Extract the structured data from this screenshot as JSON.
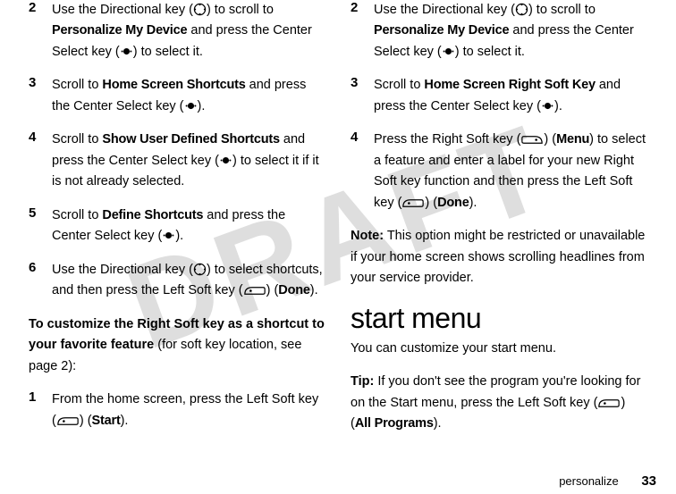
{
  "watermark": "DRAFT",
  "left_col": {
    "steps": [
      {
        "num": "2",
        "parts": [
          {
            "t": "Use the Directional key ("
          },
          {
            "icon": "dir-ring"
          },
          {
            "t": ") to scroll to "
          },
          {
            "t": "Personalize My Device",
            "bold": true
          },
          {
            "t": " and press the Center Select key ("
          },
          {
            "icon": "center-dot"
          },
          {
            "t": ") to select it."
          }
        ]
      },
      {
        "num": "3",
        "parts": [
          {
            "t": "Scroll to "
          },
          {
            "t": "Home Screen Shortcuts",
            "bold": true
          },
          {
            "t": " and press the Center Select key ("
          },
          {
            "icon": "center-dot"
          },
          {
            "t": ")."
          }
        ]
      },
      {
        "num": "4",
        "parts": [
          {
            "t": "Scroll to "
          },
          {
            "t": "Show User Defined Shortcuts",
            "bold": true
          },
          {
            "t": " and press the Center Select key ("
          },
          {
            "icon": "center-dot"
          },
          {
            "t": ") to select it if it is not already selected."
          }
        ]
      },
      {
        "num": "5",
        "parts": [
          {
            "t": "Scroll to "
          },
          {
            "t": "Define Shortcuts",
            "bold": true
          },
          {
            "t": " and press the Center Select key ("
          },
          {
            "icon": "center-dot"
          },
          {
            "t": ")."
          }
        ]
      },
      {
        "num": "6",
        "parts": [
          {
            "t": "Use the Directional key ("
          },
          {
            "icon": "dir-ring"
          },
          {
            "t": ") to select shortcuts, and then press the Left Soft key ("
          },
          {
            "icon": "left-soft"
          },
          {
            "t": ") ("
          },
          {
            "t": "Done",
            "bold": true
          },
          {
            "t": ")."
          }
        ]
      }
    ],
    "para_lead_bold": "To customize the Right Soft key as a shortcut to your favorite feature",
    "para_lead_rest": " (for soft key location, see page 2):",
    "steps2": [
      {
        "num": "1",
        "parts": [
          {
            "t": "From the home screen, press the Left Soft key ("
          },
          {
            "icon": "left-soft"
          },
          {
            "t": ") ("
          },
          {
            "t": "Start",
            "bold": true
          },
          {
            "t": ")."
          }
        ]
      }
    ]
  },
  "right_col": {
    "steps": [
      {
        "num": "2",
        "parts": [
          {
            "t": "Use the Directional key ("
          },
          {
            "icon": "dir-ring"
          },
          {
            "t": ") to scroll to "
          },
          {
            "t": "Personalize My Device",
            "bold": true
          },
          {
            "t": " and press the Center Select key ("
          },
          {
            "icon": "center-dot"
          },
          {
            "t": ") to select it."
          }
        ]
      },
      {
        "num": "3",
        "parts": [
          {
            "t": "Scroll to "
          },
          {
            "t": "Home Screen Right Soft Key",
            "bold": true
          },
          {
            "t": " and press the Center Select key ("
          },
          {
            "icon": "center-dot"
          },
          {
            "t": ")."
          }
        ]
      },
      {
        "num": "4",
        "parts": [
          {
            "t": "Press the Right Soft key ("
          },
          {
            "icon": "right-soft"
          },
          {
            "t": ") ("
          },
          {
            "t": "Menu",
            "bold": true
          },
          {
            "t": ") to select a feature and enter a label for your new Right Soft key function and then press the Left Soft key ("
          },
          {
            "icon": "left-soft"
          },
          {
            "t": ") ("
          },
          {
            "t": "Done",
            "bold": true
          },
          {
            "t": ")."
          }
        ]
      }
    ],
    "note_label": "Note:",
    "note_text": " This option might be restricted or unavailable if your home screen shows scrolling headlines from your service provider.",
    "heading": "start menu",
    "intro": "You can customize your start menu.",
    "tip_label": "Tip:",
    "tip_parts": [
      {
        "t": " If you don't see the program you're looking for on the Start menu, press the Left Soft key ("
      },
      {
        "icon": "left-soft"
      },
      {
        "t": ") ("
      },
      {
        "t": "All Programs",
        "bold": true
      },
      {
        "t": ")."
      }
    ]
  },
  "footer": {
    "section": "personalize",
    "page": "33"
  }
}
